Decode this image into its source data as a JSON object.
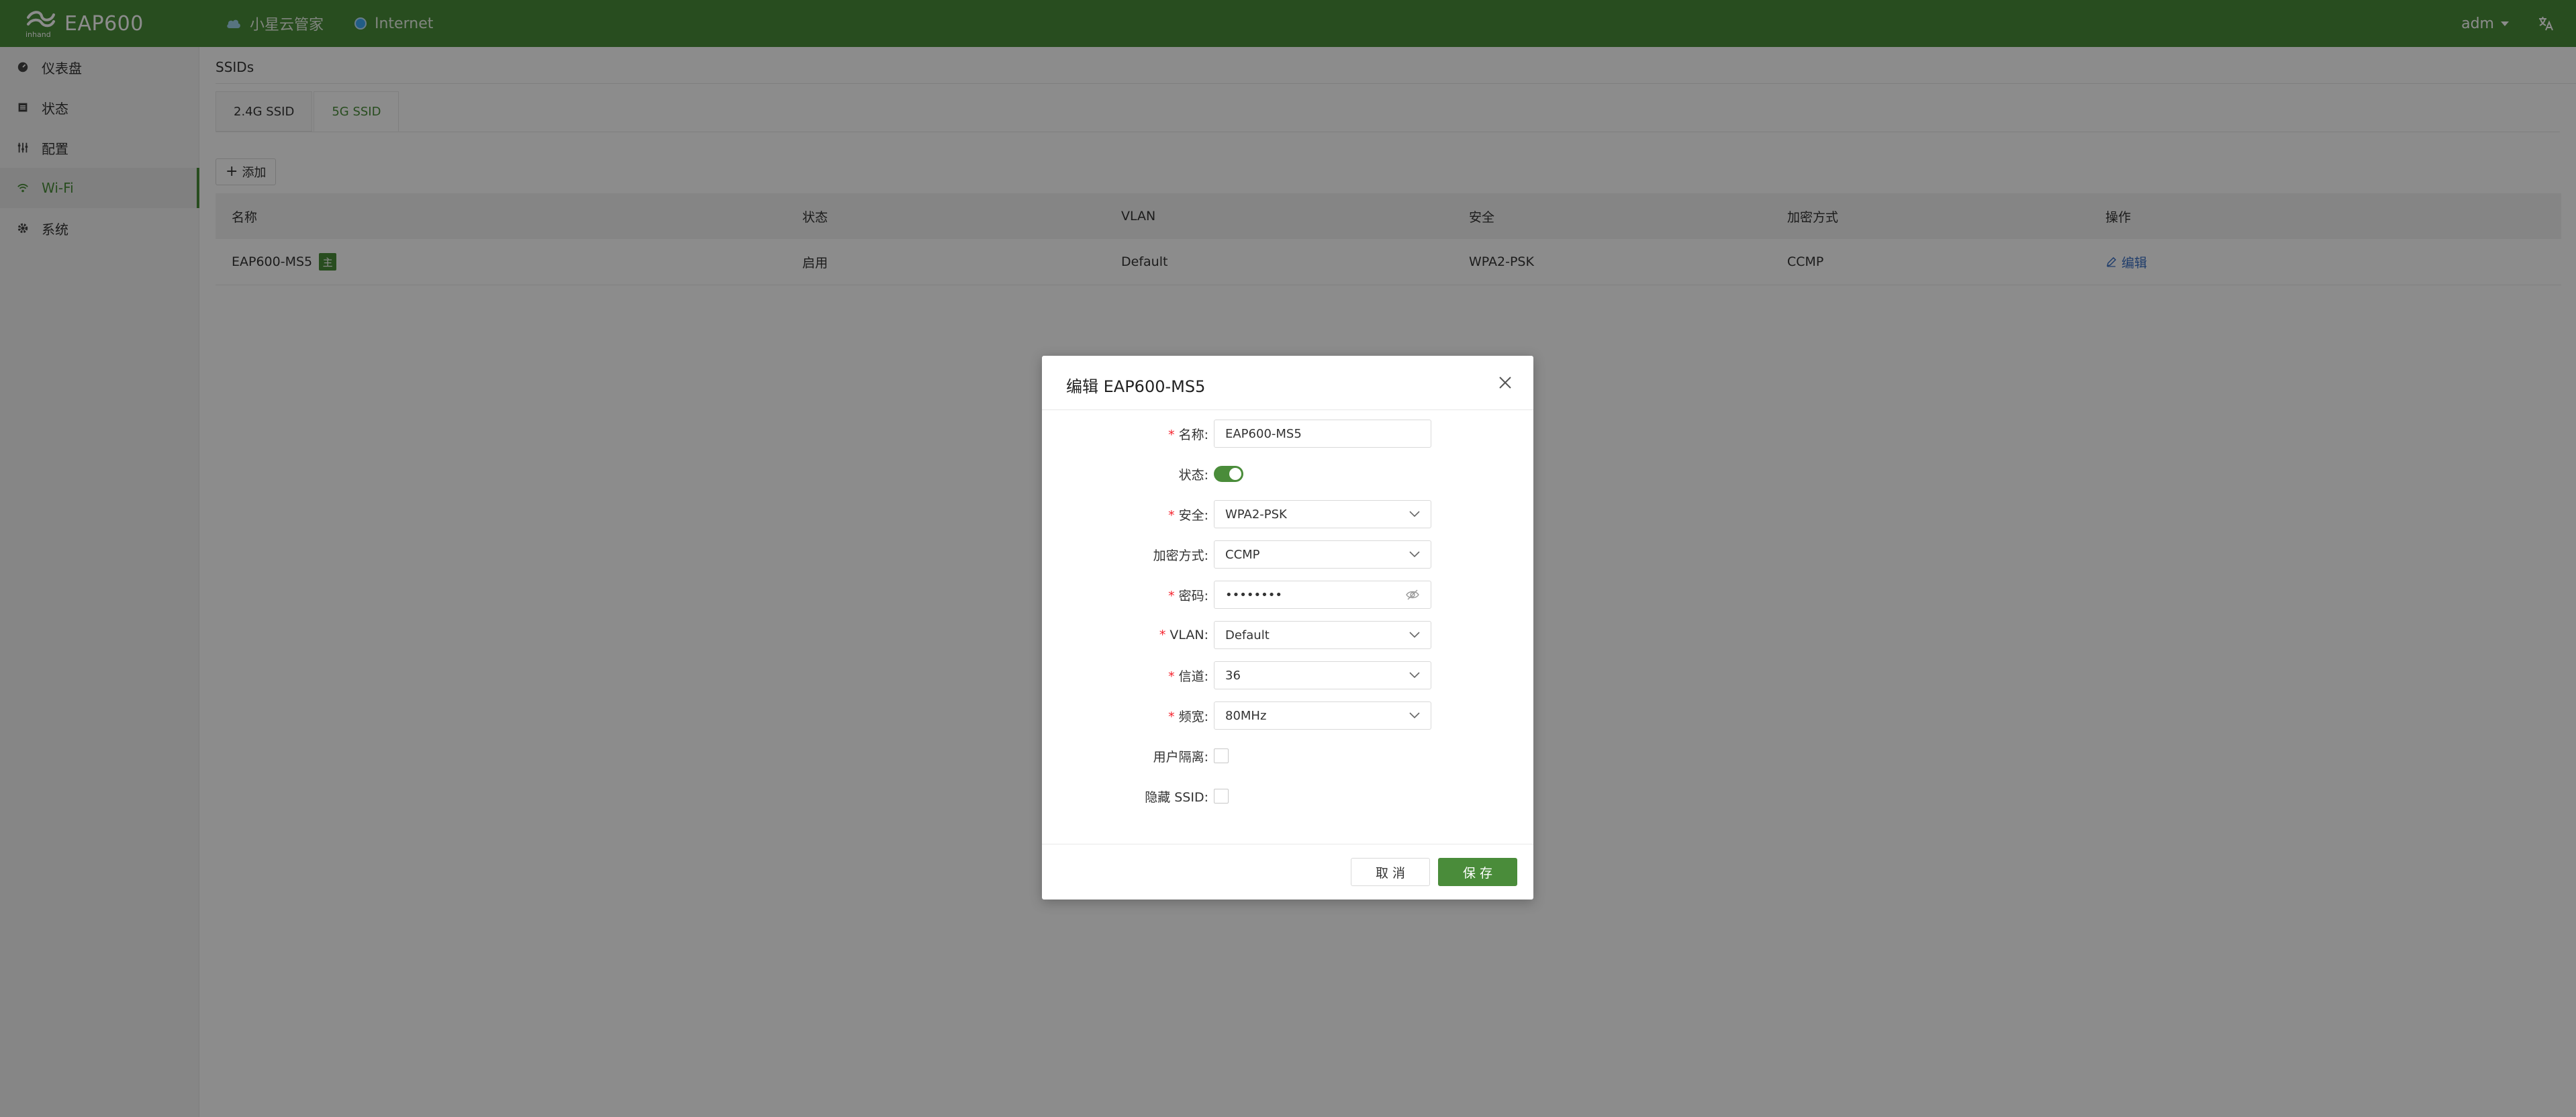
{
  "header": {
    "product_name": "EAP600",
    "logo_text": "inhand",
    "cloud_status": "小星云管家",
    "internet_status": "Internet",
    "user": "adm",
    "colors": {
      "brand": "#4a8c3a",
      "cloud_dot": "#9fd3ea",
      "internet_dot": "#3fa9f5"
    }
  },
  "sidebar": {
    "items": [
      {
        "label": "仪表盘",
        "icon": "dashboard-icon"
      },
      {
        "label": "状态",
        "icon": "status-icon"
      },
      {
        "label": "配置",
        "icon": "config-icon"
      },
      {
        "label": "Wi-Fi",
        "icon": "wifi-icon",
        "active": true
      },
      {
        "label": "系统",
        "icon": "gear-icon"
      }
    ]
  },
  "main": {
    "section_title": "SSIDs",
    "tabs": [
      {
        "label": "2.4G SSID"
      },
      {
        "label": "5G SSID",
        "active": true
      }
    ],
    "add_label": "添加",
    "table": {
      "columns": [
        "名称",
        "状态",
        "VLAN",
        "安全",
        "加密方式",
        "操作"
      ],
      "rows": [
        {
          "name": "EAP600-MS5",
          "badge": "主",
          "status": "启用",
          "vlan": "Default",
          "security": "WPA2-PSK",
          "encryption": "CCMP",
          "action": "编辑"
        }
      ]
    }
  },
  "modal": {
    "title": "编辑 EAP600-MS5",
    "fields": {
      "name": {
        "label": "名称:",
        "value": "EAP600-MS5",
        "required": true
      },
      "status": {
        "label": "状态:",
        "enabled": true
      },
      "security": {
        "label": "安全:",
        "value": "WPA2-PSK",
        "required": true
      },
      "encryption": {
        "label": "加密方式:",
        "value": "CCMP"
      },
      "password": {
        "label": "密码:",
        "value": "••••••••",
        "required": true
      },
      "vlan": {
        "label": "VLAN:",
        "value": "Default",
        "required": true
      },
      "channel": {
        "label": "信道:",
        "value": "36",
        "required": true
      },
      "bandwidth": {
        "label": "频宽:",
        "value": "80MHz",
        "required": true
      },
      "isolation": {
        "label": "用户隔离:",
        "checked": false
      },
      "hide_ssid": {
        "label": "隐藏 SSID:",
        "checked": false
      }
    },
    "cancel_label": "取 消",
    "save_label": "保 存"
  }
}
